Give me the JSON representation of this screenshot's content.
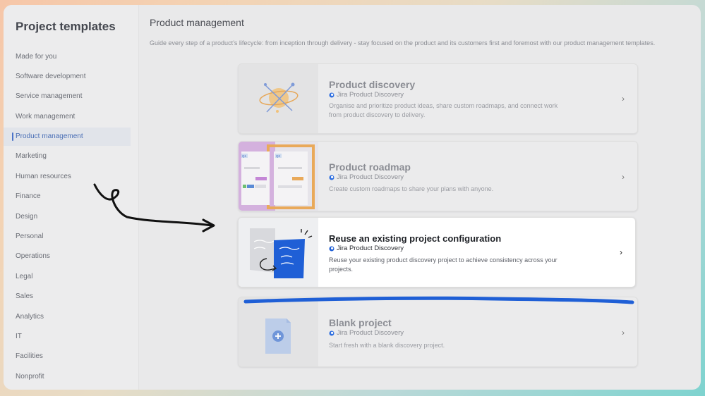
{
  "sidebar": {
    "title": "Project templates",
    "items": [
      {
        "label": "Made for you"
      },
      {
        "label": "Software development"
      },
      {
        "label": "Service management"
      },
      {
        "label": "Work management"
      },
      {
        "label": "Product management",
        "active": true
      },
      {
        "label": "Marketing"
      },
      {
        "label": "Human resources"
      },
      {
        "label": "Finance"
      },
      {
        "label": "Design"
      },
      {
        "label": "Personal"
      },
      {
        "label": "Operations"
      },
      {
        "label": "Legal"
      },
      {
        "label": "Sales"
      },
      {
        "label": "Analytics"
      },
      {
        "label": "IT"
      },
      {
        "label": "Facilities"
      },
      {
        "label": "Nonprofit"
      }
    ]
  },
  "main": {
    "title": "Product management",
    "description": "Guide every step of a product’s lifecycle: from inception through delivery - stay focused on the product and its customers first and foremost with our product management templates.",
    "cards": [
      {
        "title": "Product discovery",
        "product": "Jira Product Discovery",
        "body": "Organise and prioritize product ideas, share custom roadmaps, and connect work from product discovery to delivery.",
        "icon": "planet-illustration"
      },
      {
        "title": "Product roadmap",
        "product": "Jira Product Discovery",
        "body": "Create custom roadmaps to share your plans with anyone.",
        "icon": "roadmap-illustration",
        "q1": "Q1",
        "q2": "Q2"
      },
      {
        "title": "Reuse an existing project configuration",
        "product": "Jira Product Discovery",
        "body": "Reuse your existing product discovery project to achieve consistency across your projects.",
        "icon": "copy-pages-illustration",
        "selected": true
      },
      {
        "title": "Blank project",
        "product": "Jira Product Discovery",
        "body": "Start fresh with a blank discovery project.",
        "icon": "blank-document-illustration"
      }
    ]
  },
  "colors": {
    "accent": "#1f5fd6",
    "annotation_arrow": "#111111",
    "annotation_underline": "#1f5fd6"
  }
}
